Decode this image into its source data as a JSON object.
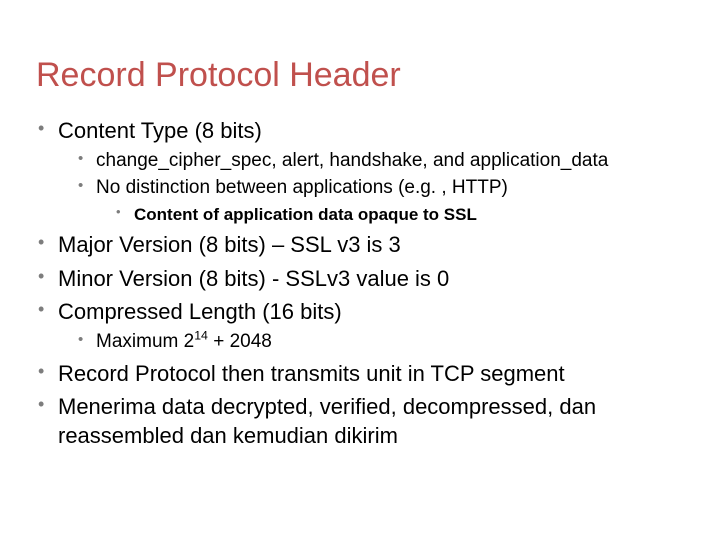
{
  "title": "Record Protocol Header",
  "items": [
    {
      "text": "Content Type (8 bits)",
      "sub": [
        {
          "text": "change_cipher_spec, alert, handshake, and application_data"
        },
        {
          "text": "No distinction between applications (e.g. , HTTP)",
          "sub": [
            {
              "text": "Content of application data opaque to SSL"
            }
          ]
        }
      ]
    },
    {
      "text": "Major Version (8 bits) – SSL v3 is 3"
    },
    {
      "text": "Minor Version (8 bits) - SSLv3 value is 0"
    },
    {
      "text": "Compressed Length (16 bits)",
      "sub": [
        {
          "text_html": "Maximum 2<sup>14</sup> + 2048"
        }
      ]
    },
    {
      "text": "Record Protocol then transmits unit in TCP segment"
    },
    {
      "text": "Menerima data decrypted, verified, decompressed, dan reassembled dan kemudian dikirim"
    }
  ]
}
